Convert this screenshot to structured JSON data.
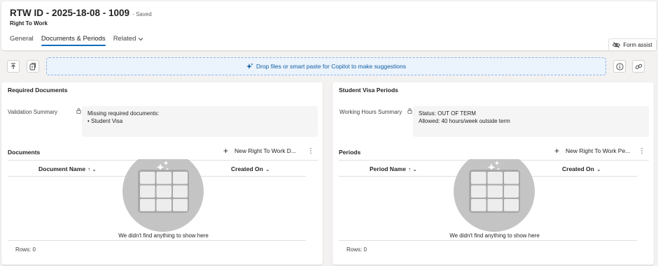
{
  "header": {
    "title": "RTW ID - 2025-18-08 - 1009",
    "status": "- Saved",
    "subtitle": "Right To Work",
    "tabs": [
      {
        "label": "General"
      },
      {
        "label": "Documents & Periods",
        "active": true
      },
      {
        "label": "Related"
      }
    ]
  },
  "form_assist": {
    "label": "Form assist"
  },
  "toolbar": {
    "dropzone_text": "Drop files or smart paste for Copilot to make suggestions"
  },
  "left_card": {
    "title": "Required Documents",
    "field_label": "Validation Summary",
    "field_lines": [
      "Missing required documents:",
      "• Student Visa"
    ],
    "subgrid_title": "Documents",
    "new_label": "New Right To Work D...",
    "columns": [
      "Document Name",
      "Created On"
    ],
    "empty_text": "We didn't find anything to show here",
    "rows_text": "Rows: 0"
  },
  "right_card": {
    "title": "Student Visa Periods",
    "field_label": "Working Hours Summary",
    "field_lines": [
      "Status: OUT OF TERM",
      "Allowed: 40 hours/week outside term"
    ],
    "subgrid_title": "Periods",
    "new_label": "New Right To Work Pe...",
    "columns": [
      "Period Name",
      "Created On"
    ],
    "empty_text": "We didn't find anything to show here",
    "rows_text": "Rows: 0"
  },
  "colors": {
    "accent": "#0f6cbd",
    "dropzone_bg": "#ebf3fc",
    "empty_art": "#c4c4c4"
  }
}
